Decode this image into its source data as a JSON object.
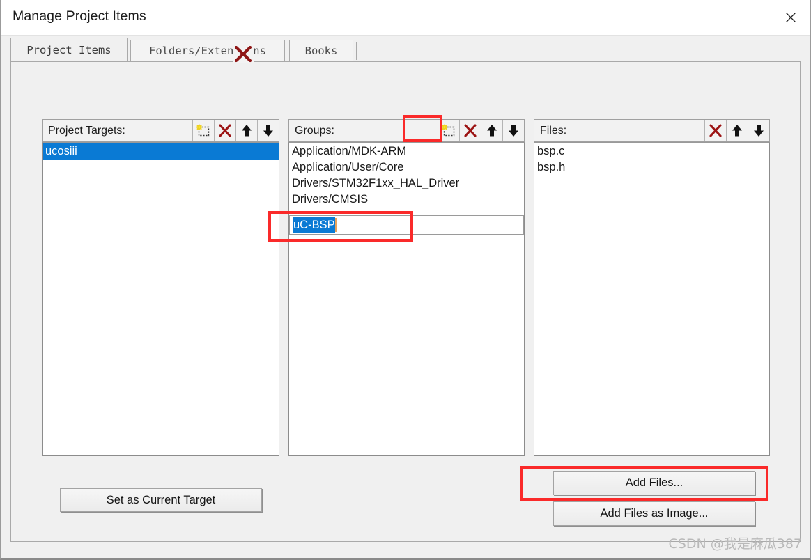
{
  "window": {
    "title": "Manage Project Items",
    "close_icon": "close-icon"
  },
  "tabs": [
    {
      "label": "Project Items",
      "active": true
    },
    {
      "label": "Folders/Extensions",
      "active": false
    },
    {
      "label": "Books",
      "active": false
    }
  ],
  "overlay": {
    "x_cursor_icon": "red-x-icon"
  },
  "panels": {
    "targets": {
      "header": "Project Targets:",
      "tools": [
        {
          "name": "new-item-icon",
          "title": "New (Insert)"
        },
        {
          "name": "delete-icon",
          "title": "Delete"
        },
        {
          "name": "move-up-icon",
          "title": "Move Up"
        },
        {
          "name": "move-down-icon",
          "title": "Move Down"
        }
      ],
      "items": [
        {
          "label": "ucosiii",
          "selected": true
        }
      ]
    },
    "groups": {
      "header": "Groups:",
      "tools": [
        {
          "name": "new-item-icon",
          "title": "New (Insert)"
        },
        {
          "name": "delete-icon",
          "title": "Delete"
        },
        {
          "name": "move-up-icon",
          "title": "Move Up"
        },
        {
          "name": "move-down-icon",
          "title": "Move Down"
        }
      ],
      "items": [
        {
          "label": "Application/MDK-ARM",
          "selected": false
        },
        {
          "label": "Application/User/Core",
          "selected": false
        },
        {
          "label": "Drivers/STM32F1xx_HAL_Driver",
          "selected": false
        },
        {
          "label": "Drivers/CMSIS",
          "selected": false
        }
      ],
      "edit_field": {
        "value": "uC-BSP",
        "selected": true
      }
    },
    "files": {
      "header": "Files:",
      "tools": [
        {
          "name": "delete-icon",
          "title": "Delete"
        },
        {
          "name": "move-up-icon",
          "title": "Move Up"
        },
        {
          "name": "move-down-icon",
          "title": "Move Down"
        }
      ],
      "items": [
        {
          "label": "bsp.c",
          "selected": false
        },
        {
          "label": "bsp.h",
          "selected": false
        }
      ]
    }
  },
  "buttons": {
    "set_as_current_target": "Set as Current Target",
    "add_files": "Add Files...",
    "add_files_as_image": "Add Files as Image..."
  },
  "annotations": {
    "groups_new_button": "highlight-groups-new-button",
    "groups_edit_field": "highlight-groups-edit-field",
    "add_files_button": "highlight-add-files-button"
  },
  "watermark": "CSDN @我是麻瓜387",
  "colors": {
    "selection": "#0a7ad4",
    "annotation": "#fa2a2a",
    "delete_icon": "#9c1414",
    "panel_bg": "#f0f0f0"
  }
}
